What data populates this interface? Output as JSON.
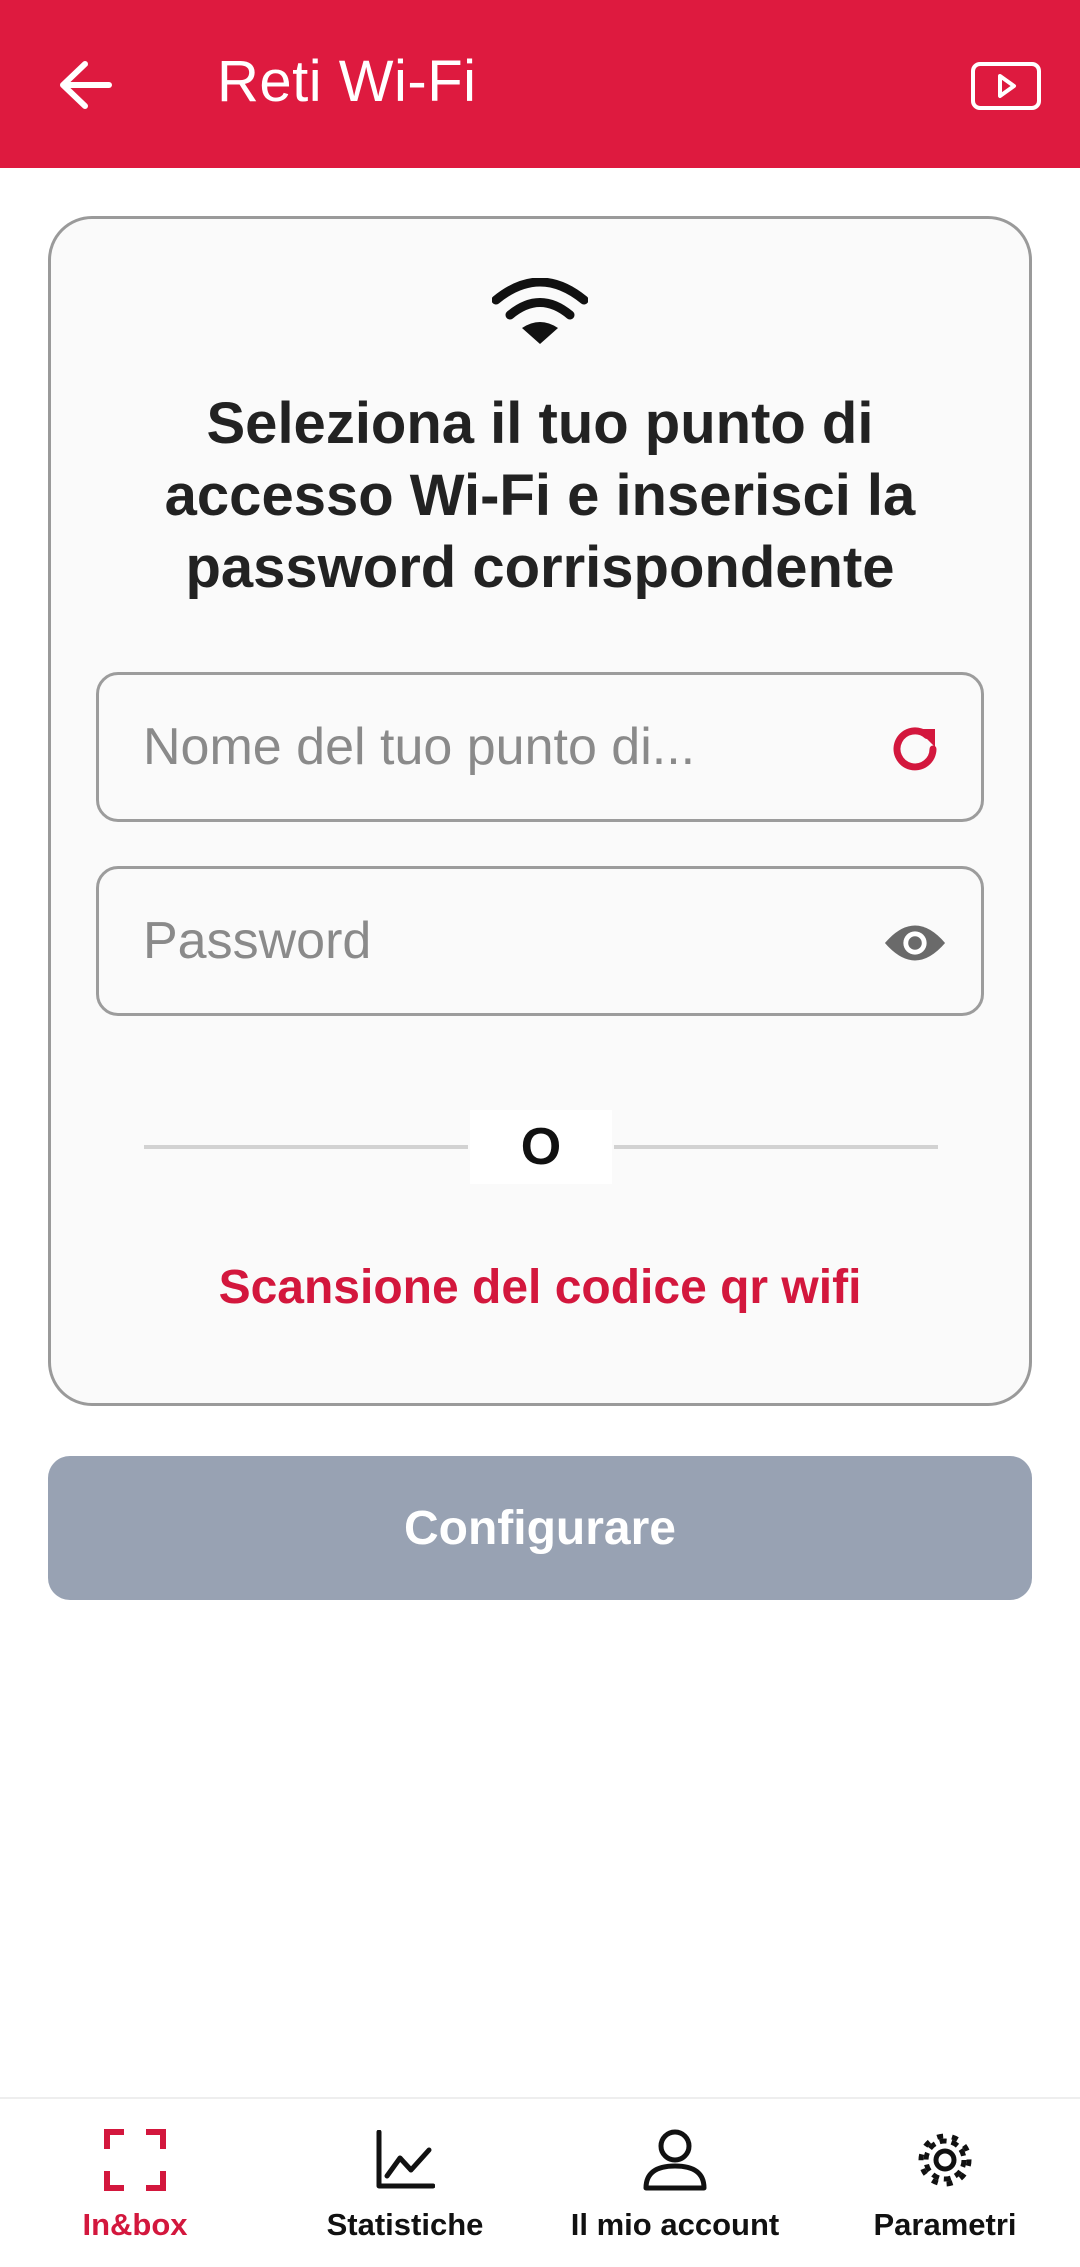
{
  "colors": {
    "brand": "#de1a3f",
    "accent": "#d3173d",
    "disabled_button": "#98a2b3"
  },
  "appbar": {
    "title": "Reti Wi-Fi",
    "back_icon": "arrow-left-icon",
    "action_icon": "video-play-icon"
  },
  "card": {
    "icon": "wifi-icon",
    "headline": "Seleziona il tuo punto di accesso Wi-Fi e inserisci la password corrispondente",
    "ssid_field": {
      "placeholder": "Nome del tuo punto di...",
      "value": "",
      "trailing_icon": "refresh-icon"
    },
    "password_field": {
      "placeholder": "Password",
      "value": "",
      "trailing_icon": "eye-icon"
    },
    "divider_text": "O",
    "scan_link": "Scansione del codice qr wifi"
  },
  "primary_button": {
    "label": "Configurare"
  },
  "bottom_nav": {
    "items": [
      {
        "label": "In&box",
        "icon": "scan-frame-icon",
        "active": true
      },
      {
        "label": "Statistiche",
        "icon": "chart-line-icon",
        "active": false
      },
      {
        "label": "Il mio account",
        "icon": "user-icon",
        "active": false
      },
      {
        "label": "Parametri",
        "icon": "gear-icon",
        "active": false
      }
    ]
  }
}
